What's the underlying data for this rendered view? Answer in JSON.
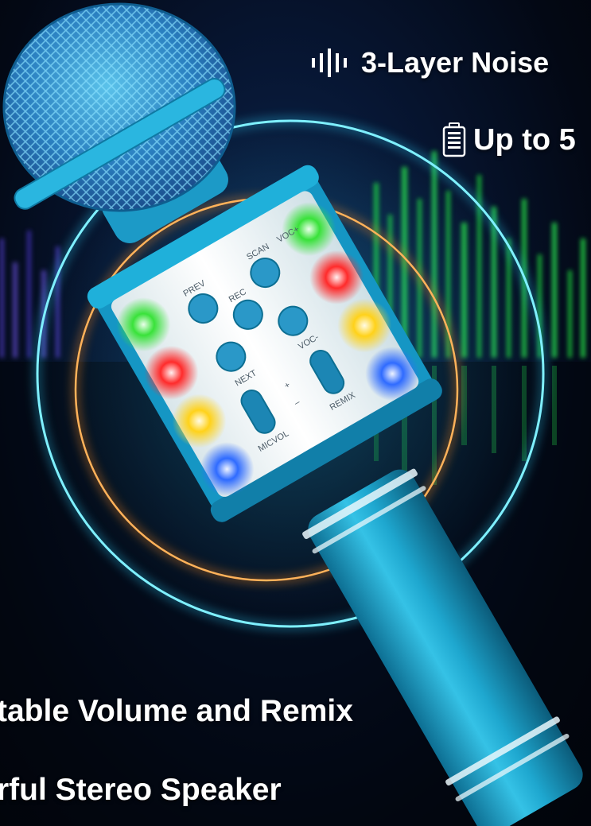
{
  "features": {
    "noise": "3-Layer Noise",
    "battery": "Up to 5",
    "volume": "table Volume and Remix",
    "speaker": "rful Stereo Speaker"
  },
  "mic_buttons": {
    "prev": "PREV",
    "scan": "SCAN",
    "voc_plus": "VOC+",
    "voc_minus": "VOC-",
    "rec": "REC",
    "next": "NEXT",
    "plus": "+",
    "minus": "–",
    "micvol": "MICVOL",
    "remix": "REMIX"
  },
  "icons": {
    "noise": "sound-wave-icon",
    "battery": "battery-icon"
  },
  "colors": {
    "mic_body": "#1aa7d0",
    "ring_cyan": "#2fd6ff",
    "ring_orange": "#ff8a1e",
    "eq_green": "#1fdc3c"
  }
}
